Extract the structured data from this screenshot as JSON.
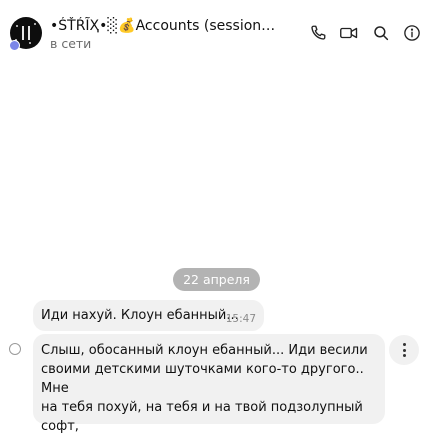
{
  "header": {
    "title": "•ŚŤŔĨҲ•░💰Accounts (session…",
    "status": "в сети",
    "icons": [
      "phone-icon",
      "video-call-icon",
      "search-icon",
      "info-icon"
    ]
  },
  "colors": {
    "presence_dot": "#7b86e8",
    "bubble_bg": "#f1f1f1",
    "date_pill_bg": "#b3b3b3"
  },
  "messages": {
    "date_separator": "22 апреля",
    "items": [
      {
        "text": "Иди нахуй. Клоун ебанный...",
        "time": "15:47"
      },
      {
        "text": "Слыш, обосанный клоун ебанный... Иди весили\nсвоими детскими шуточками кого-то другого.. Мне\nна тебя похуй, на тебя и на твой подзолупный софт,"
      }
    ]
  }
}
